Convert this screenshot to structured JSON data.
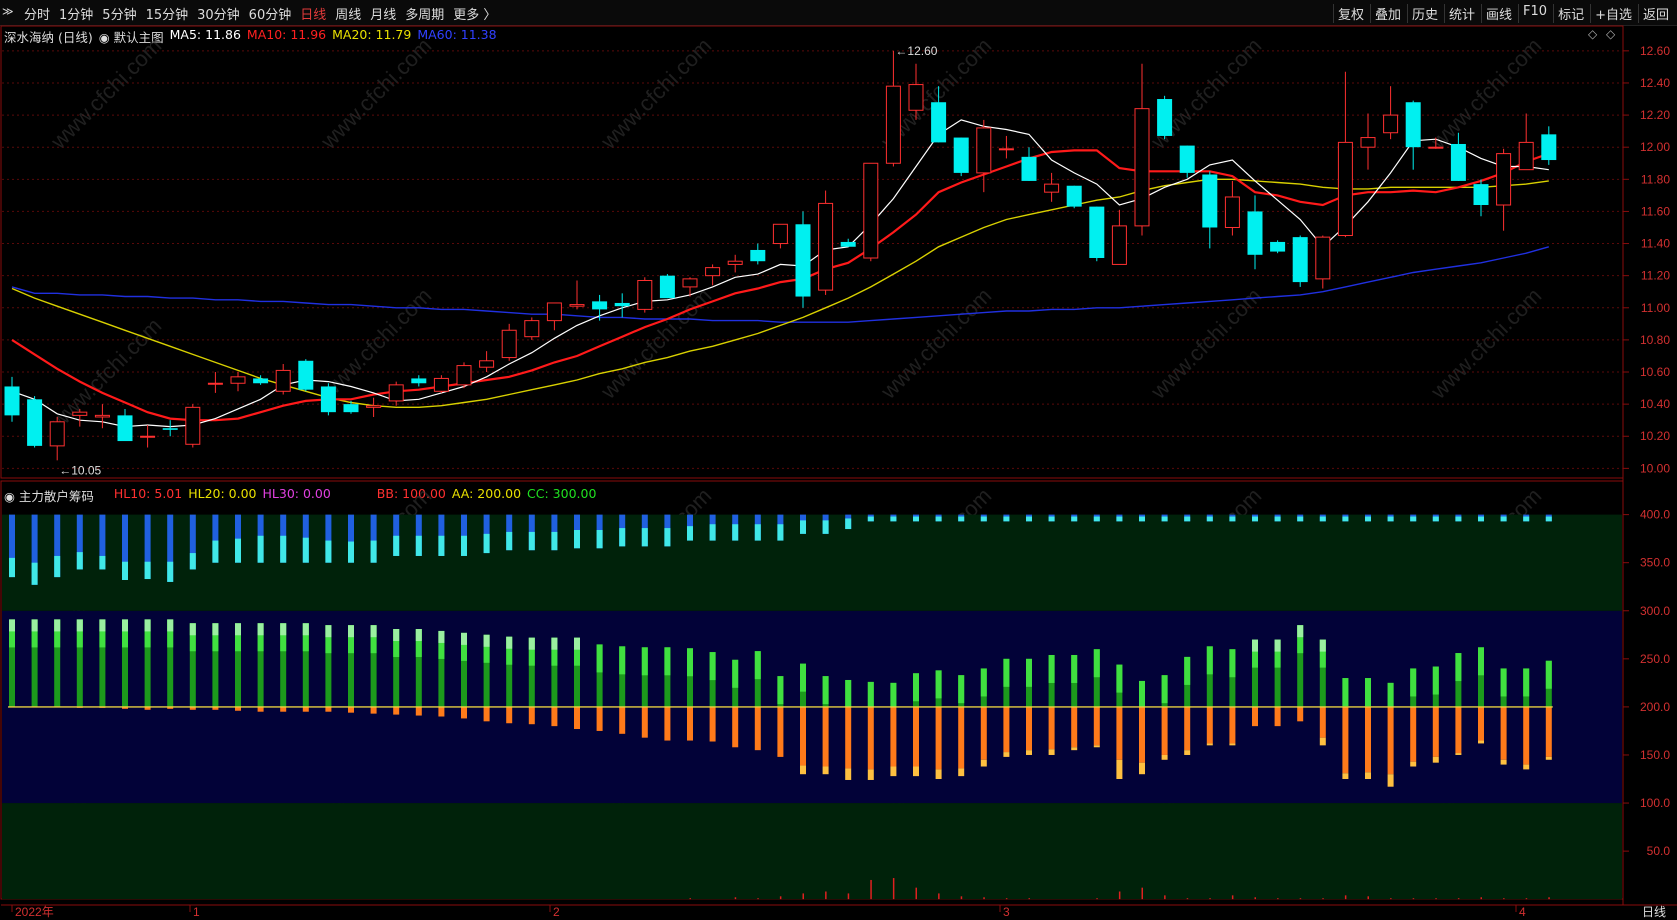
{
  "toolbar": {
    "corner_icon": "double-chevron-icon",
    "left_items": [
      "分时",
      "1分钟",
      "5分钟",
      "15分钟",
      "30分钟",
      "60分钟",
      "日线",
      "周线",
      "月线",
      "多周期",
      "更多 〉"
    ],
    "active_item": "日线",
    "right_items": [
      "复权",
      "叠加",
      "历史",
      "统计",
      "画线",
      "F10",
      "+自选",
      "返回"
    ],
    "mark_label": "标记"
  },
  "main_legend": {
    "stock": "深水海纳 (日线)",
    "style": "默认主图",
    "ma5": "MA5: 11.86",
    "ma10": "MA10: 11.96",
    "ma20": "MA20: 11.79",
    "ma60": "MA60: 11.38",
    "colors": {
      "ma5": "#ffffff",
      "ma10": "#ff2020",
      "ma20": "#e8e000",
      "ma60": "#2030ff"
    }
  },
  "sub_legend": {
    "name": "主力散户筹码",
    "hl10": "HL10: 5.01",
    "hl20": "HL20: 0.00",
    "hl30": "HL30: 0.00",
    "bb": "BB: 100.00",
    "aa": "AA: 200.00",
    "cc": "CC: 300.00",
    "colors": {
      "hl10": "#ff3030",
      "hl20": "#e8e000",
      "hl30": "#e040e0",
      "bb": "#ff3030",
      "aa": "#e8e000",
      "cc": "#20e020"
    }
  },
  "bottom_axis": {
    "labels": [
      "2022年",
      "1",
      "2",
      "3",
      "4"
    ],
    "right_label": "日线"
  },
  "watermark": "www.cfchi.com",
  "chart_data": [
    {
      "type": "candlestick",
      "y_ticks": [
        "12.60",
        "12.40",
        "12.20",
        "12.00",
        "11.80",
        "11.60",
        "11.40",
        "11.20",
        "11.00",
        "10.80",
        "10.60",
        "10.40",
        "10.20",
        "10.00"
      ],
      "ylim": [
        9.94,
        12.68
      ],
      "annotations": [
        {
          "text": "12.60",
          "value": 12.6,
          "index": 39
        },
        {
          "text": "10.05",
          "value": 10.05,
          "index": 2
        }
      ],
      "candles": [
        {
          "o": 10.51,
          "h": 10.57,
          "l": 10.29,
          "c": 10.33
        },
        {
          "o": 10.43,
          "h": 10.45,
          "l": 10.13,
          "c": 10.14
        },
        {
          "o": 10.14,
          "h": 10.32,
          "l": 10.05,
          "c": 10.29
        },
        {
          "o": 10.33,
          "h": 10.37,
          "l": 10.26,
          "c": 10.35
        },
        {
          "o": 10.32,
          "h": 10.4,
          "l": 10.25,
          "c": 10.33
        },
        {
          "o": 10.33,
          "h": 10.37,
          "l": 10.18,
          "c": 10.17
        },
        {
          "o": 10.2,
          "h": 10.27,
          "l": 10.13,
          "c": 10.2
        },
        {
          "o": 10.25,
          "h": 10.3,
          "l": 10.2,
          "c": 10.24
        },
        {
          "o": 10.15,
          "h": 10.4,
          "l": 10.13,
          "c": 10.38
        },
        {
          "o": 10.53,
          "h": 10.6,
          "l": 10.47,
          "c": 10.53
        },
        {
          "o": 10.53,
          "h": 10.6,
          "l": 10.48,
          "c": 10.57
        },
        {
          "o": 10.56,
          "h": 10.58,
          "l": 10.52,
          "c": 10.53
        },
        {
          "o": 10.48,
          "h": 10.65,
          "l": 10.46,
          "c": 10.61
        },
        {
          "o": 10.67,
          "h": 10.68,
          "l": 10.48,
          "c": 10.49
        },
        {
          "o": 10.51,
          "h": 10.53,
          "l": 10.33,
          "c": 10.35
        },
        {
          "o": 10.4,
          "h": 10.42,
          "l": 10.34,
          "c": 10.35
        },
        {
          "o": 10.38,
          "h": 10.44,
          "l": 10.32,
          "c": 10.39
        },
        {
          "o": 10.42,
          "h": 10.54,
          "l": 10.39,
          "c": 10.52
        },
        {
          "o": 10.56,
          "h": 10.58,
          "l": 10.51,
          "c": 10.53
        },
        {
          "o": 10.48,
          "h": 10.58,
          "l": 10.47,
          "c": 10.56
        },
        {
          "o": 10.52,
          "h": 10.66,
          "l": 10.5,
          "c": 10.64
        },
        {
          "o": 10.63,
          "h": 10.73,
          "l": 10.6,
          "c": 10.67
        },
        {
          "o": 10.69,
          "h": 10.9,
          "l": 10.67,
          "c": 10.86
        },
        {
          "o": 10.82,
          "h": 10.94,
          "l": 10.8,
          "c": 10.92
        },
        {
          "o": 10.92,
          "h": 11.03,
          "l": 10.86,
          "c": 11.03
        },
        {
          "o": 11.01,
          "h": 11.17,
          "l": 10.99,
          "c": 11.02
        },
        {
          "o": 11.04,
          "h": 11.08,
          "l": 10.92,
          "c": 10.99
        },
        {
          "o": 11.03,
          "h": 11.09,
          "l": 10.94,
          "c": 11.01
        },
        {
          "o": 10.99,
          "h": 11.19,
          "l": 10.97,
          "c": 11.17
        },
        {
          "o": 11.2,
          "h": 11.21,
          "l": 11.06,
          "c": 11.06
        },
        {
          "o": 11.13,
          "h": 11.19,
          "l": 11.07,
          "c": 11.18
        },
        {
          "o": 11.2,
          "h": 11.27,
          "l": 11.14,
          "c": 11.25
        },
        {
          "o": 11.27,
          "h": 11.33,
          "l": 11.22,
          "c": 11.29
        },
        {
          "o": 11.36,
          "h": 11.4,
          "l": 11.27,
          "c": 11.29
        },
        {
          "o": 11.4,
          "h": 11.5,
          "l": 11.37,
          "c": 11.52
        },
        {
          "o": 11.52,
          "h": 11.6,
          "l": 11.0,
          "c": 11.07
        },
        {
          "o": 11.11,
          "h": 11.73,
          "l": 11.08,
          "c": 11.65
        },
        {
          "o": 11.41,
          "h": 11.43,
          "l": 11.38,
          "c": 11.38
        },
        {
          "o": 11.31,
          "h": 11.9,
          "l": 11.29,
          "c": 11.9
        },
        {
          "o": 11.9,
          "h": 12.6,
          "l": 11.88,
          "c": 12.38
        },
        {
          "o": 12.23,
          "h": 12.52,
          "l": 12.17,
          "c": 12.39
        },
        {
          "o": 12.28,
          "h": 12.38,
          "l": 12.03,
          "c": 12.03
        },
        {
          "o": 12.06,
          "h": 12.06,
          "l": 11.82,
          "c": 11.84
        },
        {
          "o": 11.84,
          "h": 12.17,
          "l": 11.72,
          "c": 12.12
        },
        {
          "o": 11.99,
          "h": 12.07,
          "l": 11.93,
          "c": 11.99
        },
        {
          "o": 11.94,
          "h": 12.0,
          "l": 11.79,
          "c": 11.79
        },
        {
          "o": 11.72,
          "h": 11.84,
          "l": 11.66,
          "c": 11.77
        },
        {
          "o": 11.76,
          "h": 11.76,
          "l": 11.62,
          "c": 11.63
        },
        {
          "o": 11.63,
          "h": 11.63,
          "l": 11.29,
          "c": 11.31
        },
        {
          "o": 11.27,
          "h": 11.61,
          "l": 11.27,
          "c": 11.51
        },
        {
          "o": 11.51,
          "h": 12.52,
          "l": 11.45,
          "c": 12.24
        },
        {
          "o": 12.3,
          "h": 12.32,
          "l": 12.05,
          "c": 12.07
        },
        {
          "o": 12.01,
          "h": 12.01,
          "l": 11.81,
          "c": 11.84
        },
        {
          "o": 11.83,
          "h": 11.85,
          "l": 11.37,
          "c": 11.5
        },
        {
          "o": 11.5,
          "h": 11.79,
          "l": 11.45,
          "c": 11.69
        },
        {
          "o": 11.6,
          "h": 11.7,
          "l": 11.24,
          "c": 11.33
        },
        {
          "o": 11.41,
          "h": 11.42,
          "l": 11.34,
          "c": 11.35
        },
        {
          "o": 11.44,
          "h": 11.45,
          "l": 11.13,
          "c": 11.16
        },
        {
          "o": 11.18,
          "h": 11.45,
          "l": 11.12,
          "c": 11.44
        },
        {
          "o": 11.45,
          "h": 12.47,
          "l": 11.44,
          "c": 12.03
        },
        {
          "o": 12.0,
          "h": 12.21,
          "l": 11.86,
          "c": 12.06
        },
        {
          "o": 12.09,
          "h": 12.38,
          "l": 12.05,
          "c": 12.2
        },
        {
          "o": 12.28,
          "h": 12.29,
          "l": 11.86,
          "c": 12.0
        },
        {
          "o": 12.0,
          "h": 12.06,
          "l": 11.99,
          "c": 12.0
        },
        {
          "o": 12.02,
          "h": 12.09,
          "l": 11.79,
          "c": 11.79
        },
        {
          "o": 11.77,
          "h": 11.8,
          "l": 11.57,
          "c": 11.64
        },
        {
          "o": 11.64,
          "h": 11.99,
          "l": 11.48,
          "c": 11.96
        },
        {
          "o": 11.86,
          "h": 12.21,
          "l": 11.86,
          "c": 12.03
        },
        {
          "o": 12.08,
          "h": 12.13,
          "l": 11.89,
          "c": 11.92
        }
      ],
      "ma5": [
        10.48,
        10.43,
        10.34,
        10.3,
        10.29,
        10.26,
        10.27,
        10.26,
        10.27,
        10.31,
        10.37,
        10.43,
        10.52,
        10.55,
        10.54,
        10.51,
        10.47,
        10.42,
        10.43,
        10.47,
        10.51,
        10.57,
        10.65,
        10.72,
        10.81,
        10.89,
        10.95,
        11.0,
        11.04,
        11.05,
        11.08,
        11.13,
        11.19,
        11.21,
        11.27,
        11.26,
        11.36,
        11.38,
        11.52,
        11.68,
        11.88,
        12.08,
        12.17,
        12.13,
        12.11,
        12.08,
        11.92,
        11.84,
        11.77,
        11.64,
        11.68,
        11.75,
        11.8,
        11.89,
        11.92,
        11.79,
        11.67,
        11.55,
        11.38,
        11.51,
        11.66,
        11.84,
        12.04,
        12.05,
        12.0,
        11.93,
        11.88,
        11.88,
        11.86
      ],
      "ma10": [
        10.8,
        10.71,
        10.62,
        10.54,
        10.47,
        10.41,
        10.35,
        10.31,
        10.3,
        10.3,
        10.31,
        10.35,
        10.39,
        10.42,
        10.43,
        10.43,
        10.46,
        10.48,
        10.49,
        10.51,
        10.53,
        10.55,
        10.57,
        10.61,
        10.66,
        10.7,
        10.76,
        10.82,
        10.88,
        10.93,
        10.99,
        11.04,
        11.09,
        11.12,
        11.16,
        11.18,
        11.24,
        11.28,
        11.37,
        11.47,
        11.58,
        11.72,
        11.78,
        11.83,
        11.88,
        11.93,
        11.97,
        11.98,
        11.98,
        11.87,
        11.85,
        11.85,
        11.85,
        11.85,
        11.82,
        11.72,
        11.7,
        11.66,
        11.64,
        11.7,
        11.72,
        11.72,
        11.73,
        11.72,
        11.75,
        11.79,
        11.84,
        11.91,
        11.96
      ],
      "ma20": [
        11.12,
        11.06,
        11.01,
        10.96,
        10.91,
        10.86,
        10.81,
        10.76,
        10.71,
        10.66,
        10.61,
        10.56,
        10.52,
        10.48,
        10.44,
        10.41,
        10.39,
        10.38,
        10.38,
        10.39,
        10.41,
        10.43,
        10.46,
        10.49,
        10.52,
        10.55,
        10.59,
        10.62,
        10.66,
        10.69,
        10.73,
        10.76,
        10.8,
        10.84,
        10.89,
        10.94,
        11.0,
        11.06,
        11.13,
        11.21,
        11.29,
        11.38,
        11.44,
        11.5,
        11.55,
        11.58,
        11.61,
        11.64,
        11.67,
        11.69,
        11.73,
        11.76,
        11.78,
        11.8,
        11.8,
        11.79,
        11.78,
        11.77,
        11.75,
        11.74,
        11.74,
        11.75,
        11.75,
        11.75,
        11.75,
        11.75,
        11.76,
        11.77,
        11.79
      ],
      "ma60": [
        11.13,
        11.09,
        11.09,
        11.08,
        11.08,
        11.07,
        11.07,
        11.06,
        11.06,
        11.05,
        11.05,
        11.04,
        11.04,
        11.03,
        11.02,
        11.02,
        11.01,
        11.0,
        11.0,
        10.99,
        10.99,
        10.98,
        10.97,
        10.96,
        10.96,
        10.95,
        10.94,
        10.94,
        10.93,
        10.93,
        10.93,
        10.92,
        10.92,
        10.92,
        10.91,
        10.91,
        10.91,
        10.91,
        10.92,
        10.93,
        10.94,
        10.95,
        10.96,
        10.97,
        10.98,
        10.98,
        10.99,
        10.99,
        11.0,
        11.0,
        11.01,
        11.02,
        11.03,
        11.04,
        11.05,
        11.06,
        11.07,
        11.08,
        11.1,
        11.13,
        11.16,
        11.19,
        11.22,
        11.24,
        11.26,
        11.28,
        11.31,
        11.34,
        11.38
      ]
    },
    {
      "type": "bar",
      "y_ticks": [
        "400.0",
        "350.0",
        "300.0",
        "250.0",
        "200.0",
        "150.0",
        "100.0",
        "50.0"
      ],
      "ylim": [
        -5,
        410
      ],
      "bands": [
        {
          "from": 0,
          "to": 100,
          "color": "#00220a"
        },
        {
          "from": 100,
          "to": 300,
          "color": "#020238"
        },
        {
          "from": 300,
          "to": 400,
          "color": "#00220a"
        }
      ],
      "baseline": 200,
      "top_blue": [
        335,
        327,
        335,
        343,
        343,
        332,
        333,
        330,
        343,
        350,
        350,
        350,
        350,
        350,
        350,
        350,
        350,
        357,
        357,
        357,
        357,
        360,
        363,
        363,
        363,
        365,
        365,
        367,
        367,
        367,
        373,
        373,
        373,
        373,
        373,
        380,
        380,
        385,
        393,
        393,
        393,
        393,
        393,
        393,
        393,
        393,
        393,
        393,
        393,
        393,
        393,
        393,
        393,
        393,
        393,
        393,
        393,
        393,
        393,
        393,
        393,
        393,
        393,
        393,
        393,
        393,
        393,
        393,
        393
      ],
      "top_cyan": [
        355,
        350,
        357,
        361,
        357,
        351,
        351,
        351,
        360,
        373,
        375,
        378,
        378,
        376,
        373,
        372,
        373,
        378,
        378,
        378,
        378,
        380,
        382,
        382,
        382,
        384,
        384,
        386,
        386,
        386,
        388,
        390,
        390,
        390,
        390,
        394,
        394,
        396,
        398,
        398,
        398,
        398,
        398,
        398,
        398,
        398,
        398,
        398,
        398,
        398,
        398,
        398,
        398,
        398,
        398,
        398,
        398,
        398,
        398,
        398,
        398,
        398,
        398,
        398,
        398,
        398,
        398,
        398,
        398
      ],
      "green_top": [
        291,
        291,
        291,
        291,
        291,
        291,
        291,
        291,
        287,
        287,
        287,
        287,
        287,
        287,
        285,
        285,
        285,
        281,
        281,
        279,
        277,
        275,
        273,
        272,
        272,
        272,
        265,
        263,
        262,
        262,
        261,
        257,
        249,
        258,
        232,
        245,
        232,
        228,
        226,
        225,
        235,
        238,
        233,
        240,
        250,
        250,
        254,
        254,
        260,
        244,
        227,
        233,
        252,
        263,
        260,
        270,
        270,
        285,
        270,
        230,
        230,
        225,
        240,
        242,
        256,
        262,
        240,
        240,
        248
      ],
      "orange_bottom": [
        200,
        200,
        200,
        199,
        199,
        198,
        197,
        198,
        197,
        197,
        196,
        195,
        195,
        195,
        195,
        194,
        193,
        192,
        191,
        190,
        188,
        185,
        183,
        182,
        180,
        177,
        175,
        172,
        168,
        165,
        165,
        164,
        158,
        155,
        148,
        139,
        138,
        136,
        135,
        138,
        138,
        135,
        136,
        145,
        153,
        155,
        156,
        158,
        160,
        145,
        142,
        150,
        155,
        162,
        162,
        180,
        180,
        185,
        168,
        131,
        132,
        130,
        143,
        148,
        152,
        165,
        145,
        140,
        148
      ],
      "yellow_bottom": [
        200,
        200,
        200,
        199,
        199,
        198,
        197,
        198,
        197,
        197,
        196,
        195,
        195,
        195,
        195,
        194,
        193,
        192,
        191,
        190,
        188,
        185,
        183,
        182,
        180,
        177,
        175,
        172,
        168,
        165,
        165,
        164,
        158,
        155,
        148,
        130,
        130,
        124,
        124,
        128,
        128,
        125,
        128,
        138,
        148,
        150,
        150,
        155,
        158,
        125,
        130,
        145,
        150,
        160,
        160,
        180,
        180,
        185,
        160,
        125,
        125,
        117,
        138,
        142,
        150,
        162,
        140,
        135,
        145
      ],
      "bottom_spikes": [
        0,
        0,
        0,
        0,
        0,
        0,
        0,
        0,
        0,
        0,
        0,
        0,
        0,
        0,
        0,
        0,
        0,
        0,
        0,
        0,
        0,
        0,
        0,
        0,
        0,
        0,
        0,
        0,
        0,
        0,
        1,
        0,
        2,
        1,
        3,
        6,
        8,
        6,
        20,
        22,
        12,
        6,
        3,
        2,
        1,
        1,
        0,
        0,
        1,
        8,
        12,
        4,
        1,
        1,
        4,
        2,
        1,
        1,
        1,
        4,
        3,
        1,
        1,
        1,
        1,
        2,
        1,
        1,
        2
      ]
    }
  ]
}
